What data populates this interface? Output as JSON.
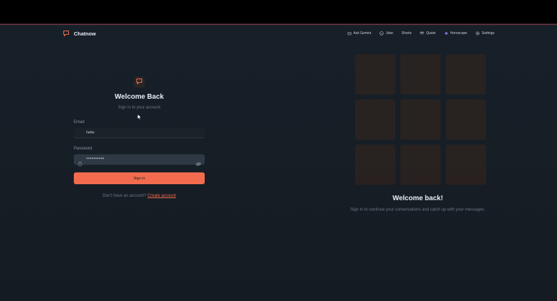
{
  "app": {
    "name": "Chatnow",
    "accent": "#f26b4e"
  },
  "nav": [
    {
      "label": "Ask Gemini",
      "icon": "robot-icon"
    },
    {
      "label": "Joke",
      "icon": "smile-icon"
    },
    {
      "label": "Shorts",
      "icon": ""
    },
    {
      "label": "Quote",
      "icon": "quote-icon"
    },
    {
      "label": "Horoscope",
      "icon": "planet-icon"
    },
    {
      "label": "Settings",
      "icon": "gear-icon"
    }
  ],
  "login": {
    "title": "Welcome Back",
    "subtitle": "Sign in to your account",
    "email_label": "Email",
    "email_value": "hello",
    "password_label": "Password",
    "password_value": "••••••••••",
    "signin_label": "Sign in",
    "no_account_text": "Don't have an account?",
    "create_account_label": "Create account"
  },
  "hero": {
    "title": "Welcome back!",
    "subtitle": "Sign in to continue your conversations and catch up with your messages."
  }
}
